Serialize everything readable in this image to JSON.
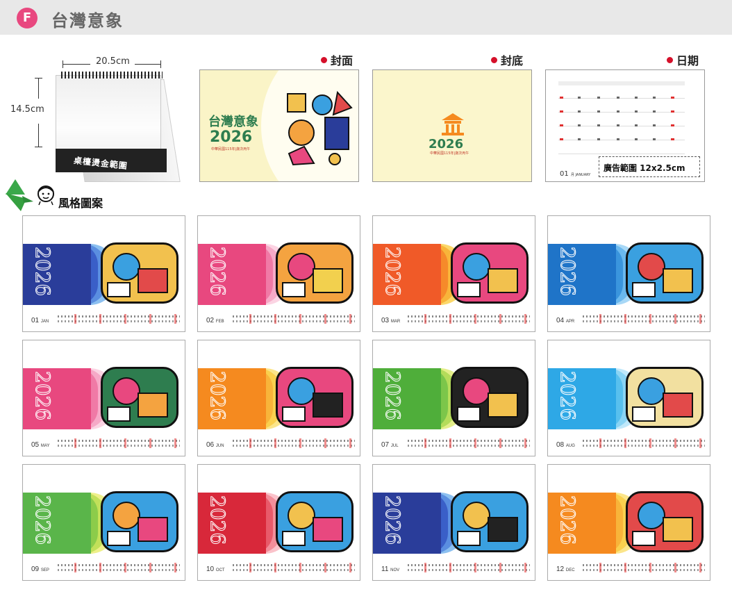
{
  "header": {
    "badge": "F",
    "title": "台灣意象"
  },
  "desk": {
    "width_label": "20.5cm",
    "height_label": "14.5cm",
    "base_text": "桌檯燙金範圍"
  },
  "previews": {
    "cover": {
      "label": "封面",
      "title": "台灣意象",
      "year": "2026",
      "sub": "中華民國115年|歲次丙午"
    },
    "back": {
      "label": "封底",
      "year": "2026",
      "sub": "中華民國115年|歲次丙午"
    },
    "date": {
      "label": "日期",
      "month": "01",
      "month_en": "月 JANUARY",
      "ad_text": "廣告範圍 12x2.5cm"
    }
  },
  "section": {
    "title": "風格圖案"
  },
  "year": "2026",
  "months": [
    {
      "num": "01",
      "abbr": "JAN",
      "colors": [
        "#2a3d9a",
        "#3a5fc8",
        "#5a8ee0",
        "#8cc0f0"
      ],
      "art": [
        "#f2c14e",
        "#3aa0e0",
        "#e24a4a"
      ]
    },
    {
      "num": "02",
      "abbr": "FEB",
      "colors": [
        "#e8487f",
        "#f07aa6",
        "#f6a9c7",
        "#fbd4e3"
      ],
      "art": [
        "#f4a340",
        "#e8487f",
        "#f2d04e"
      ]
    },
    {
      "num": "03",
      "abbr": "MAR",
      "colors": [
        "#f05a28",
        "#f68a2a",
        "#f8b43a",
        "#fbd86a"
      ],
      "art": [
        "#e8487f",
        "#3aa0e0",
        "#f2c14e"
      ]
    },
    {
      "num": "04",
      "abbr": "APR",
      "colors": [
        "#1f74c8",
        "#3a95dd",
        "#6ab8ee",
        "#a8d8f6"
      ],
      "art": [
        "#3aa0e0",
        "#e24a4a",
        "#f2c14e"
      ]
    },
    {
      "num": "05",
      "abbr": "MAY",
      "colors": [
        "#e8487f",
        "#f07aa6",
        "#f6a9c7",
        "#fbd4e3"
      ],
      "art": [
        "#2e7d4f",
        "#e8487f",
        "#f4a340"
      ]
    },
    {
      "num": "06",
      "abbr": "JUN",
      "colors": [
        "#f58a1f",
        "#f8b43a",
        "#fad04e",
        "#fbe58a"
      ],
      "art": [
        "#e8487f",
        "#3aa0e0",
        "#222222"
      ]
    },
    {
      "num": "07",
      "abbr": "JUL",
      "colors": [
        "#4fae3a",
        "#7cc64a",
        "#b4dc5a",
        "#e4ee8a"
      ],
      "art": [
        "#222222",
        "#e8487f",
        "#f2c14e"
      ]
    },
    {
      "num": "08",
      "abbr": "AUG",
      "colors": [
        "#2ea8e6",
        "#58c0ee",
        "#8ad4f4",
        "#c0e8fa"
      ],
      "art": [
        "#f2e0a0",
        "#3aa0e0",
        "#e24a4a"
      ]
    },
    {
      "num": "09",
      "abbr": "SEP",
      "colors": [
        "#5ab54a",
        "#8ccc4a",
        "#c2e05a",
        "#eef08a"
      ],
      "art": [
        "#3aa0e0",
        "#f4a340",
        "#e8487f"
      ]
    },
    {
      "num": "10",
      "abbr": "OCT",
      "colors": [
        "#d8283a",
        "#e85a6a",
        "#f28e9a",
        "#fac2ca"
      ],
      "art": [
        "#3aa0e0",
        "#f2c14e",
        "#e8487f"
      ]
    },
    {
      "num": "11",
      "abbr": "NOV",
      "colors": [
        "#2a3d9a",
        "#3a5fc8",
        "#5a8ee0",
        "#8cc0f0"
      ],
      "art": [
        "#3aa0e0",
        "#f2c14e",
        "#222222"
      ]
    },
    {
      "num": "12",
      "abbr": "DEC",
      "colors": [
        "#f58a1f",
        "#f8b43a",
        "#fad04e",
        "#fbe58a"
      ],
      "art": [
        "#e24a4a",
        "#3aa0e0",
        "#f2c14e"
      ]
    }
  ]
}
